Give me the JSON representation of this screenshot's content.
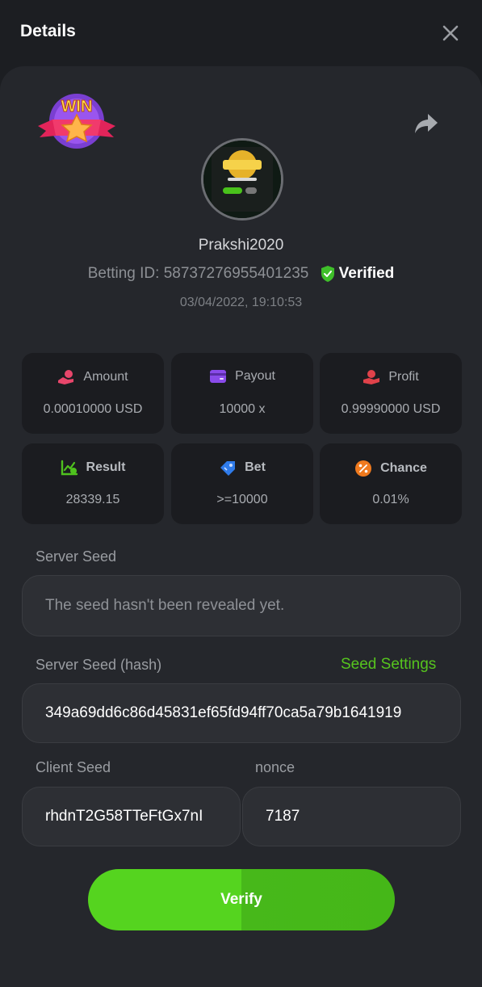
{
  "header": {
    "title": "Details"
  },
  "user": {
    "name": "Prakshi2020",
    "betting_id": "Betting ID: 58737276955401235",
    "verified_label": "Verified",
    "date": "03/04/2022, 19:10:53"
  },
  "stats": [
    {
      "label": "Amount",
      "value": "0.00010000 USD",
      "icon": "coins-hand-icon",
      "color": "#e8466b"
    },
    {
      "label": "Payout",
      "value": "10000 x",
      "icon": "wallet-card-icon",
      "color": "#8a4bea"
    },
    {
      "label": "Profit",
      "value": "0.99990000 USD",
      "icon": "hand-profit-icon",
      "color": "#e0424a"
    },
    {
      "label": "Result",
      "value": "28339.15",
      "icon": "chart-check-icon",
      "color": "#4fc21e"
    },
    {
      "label": "Bet",
      "value": ">=10000",
      "icon": "tag-icon",
      "color": "#2f7bea"
    },
    {
      "label": "Chance",
      "value": "0.01%",
      "icon": "percent-icon",
      "color": "#f07a1e"
    }
  ],
  "server_seed": {
    "label": "Server Seed",
    "placeholder": "The seed hasn't been revealed yet."
  },
  "server_seed_hash": {
    "label": "Server Seed (hash)",
    "link": "Seed Settings",
    "value": "349a69dd6c86d45831ef65fd94ff70ca5a79b1641919"
  },
  "client_seed": {
    "label": "Client Seed",
    "value": "rhdnT2G58TTeFtGx7nI"
  },
  "nonce": {
    "label": "nonce",
    "value": "7187"
  },
  "verify_button": {
    "label": "Verify"
  },
  "badge": {
    "text": "WIN"
  },
  "colors": {
    "accent": "#56c41e",
    "panel": "#25272c",
    "background": "#1c1e22"
  }
}
